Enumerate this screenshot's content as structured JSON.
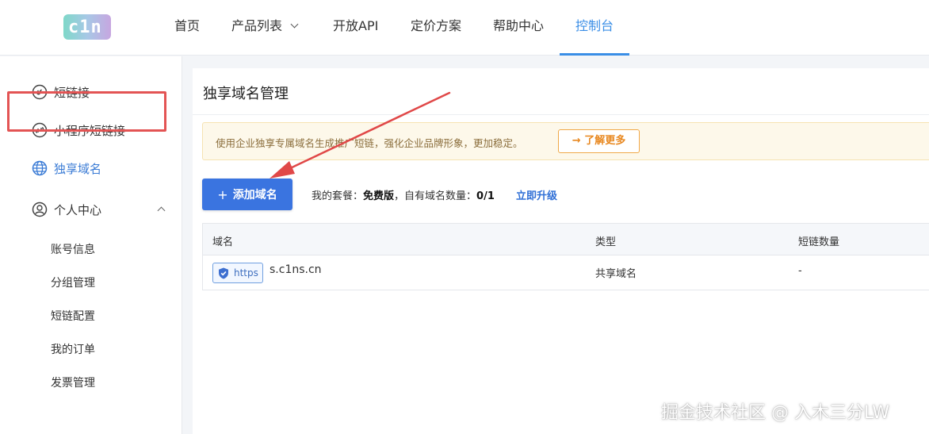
{
  "logo": {
    "text": "c1n"
  },
  "nav": {
    "items": [
      {
        "label": "首页"
      },
      {
        "label": "产品列表"
      },
      {
        "label": "开放API"
      },
      {
        "label": "定价方案"
      },
      {
        "label": "帮助中心"
      },
      {
        "label": "控制台"
      }
    ],
    "active_index": 5
  },
  "sidebar": {
    "items": [
      {
        "label": "短链接",
        "icon": "link-icon"
      },
      {
        "label": "小程序短链接",
        "icon": "miniprogram-icon"
      },
      {
        "label": "独享域名",
        "icon": "globe-icon"
      },
      {
        "label": "个人中心",
        "icon": "user-icon"
      }
    ],
    "sub_items": [
      {
        "label": "账号信息"
      },
      {
        "label": "分组管理"
      },
      {
        "label": "短链配置"
      },
      {
        "label": "我的订单"
      },
      {
        "label": "发票管理"
      }
    ]
  },
  "main": {
    "title": "独享域名管理",
    "notice": {
      "text": "使用企业独享专属域名生成推广短链，强化企业品牌形象，更加稳定。",
      "button": "→ 了解更多"
    },
    "add_button": "添加域名",
    "plan": {
      "prefix": "我的套餐：",
      "name": "免费版",
      "middle": "，自有域名数量：",
      "count": "0/1"
    },
    "upgrade": "立即升级",
    "table": {
      "headers": [
        "域名",
        "类型",
        "短链数量"
      ],
      "rows": [
        {
          "protocol": "https",
          "domain": "s.c1ns.cn",
          "type": "共享域名",
          "count": "-"
        }
      ]
    }
  },
  "watermark": "掘金技术社区 @ 入木三分LW",
  "colors": {
    "accent": "#3a8ee6",
    "primary_button": "#3a74e0",
    "highlight": "#e35454"
  }
}
